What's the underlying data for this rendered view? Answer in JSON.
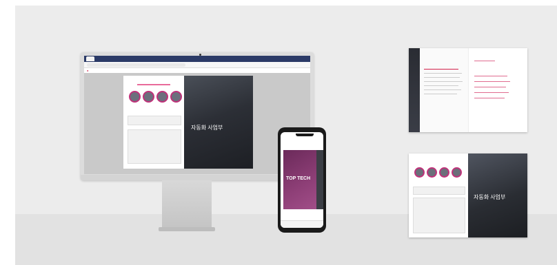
{
  "browser": {
    "tab_label": "",
    "url": ""
  },
  "brochure": {
    "hero_title": "자동화 사업부",
    "phone_title": "TOP TECH"
  },
  "colors": {
    "accent": "#c0327a",
    "brand_red": "#d11e48",
    "browser_bar": "#2b3a67"
  },
  "icons": [
    "camera-icon"
  ]
}
